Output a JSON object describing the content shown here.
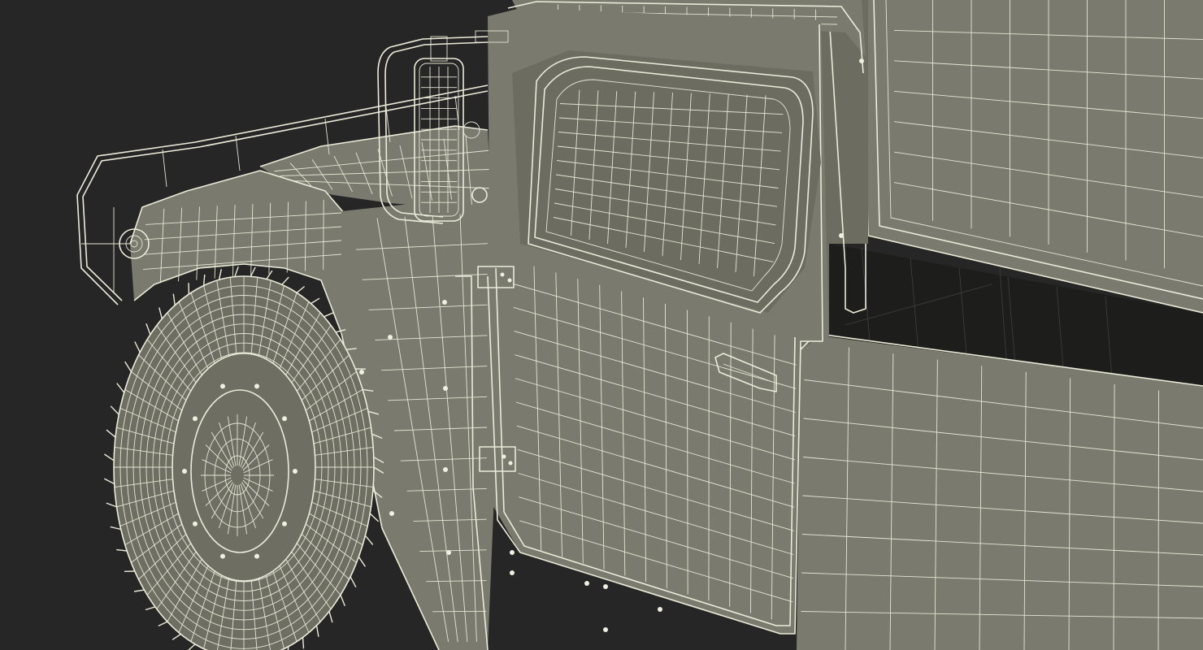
{
  "scene": {
    "subject": "wireframe-vehicle-render",
    "colors": {
      "background": "#262626",
      "body": "#7a7a6e",
      "body_shade": "#6c6c61",
      "wire": "#ecebd9",
      "cavity": "#1d1d1b"
    }
  }
}
